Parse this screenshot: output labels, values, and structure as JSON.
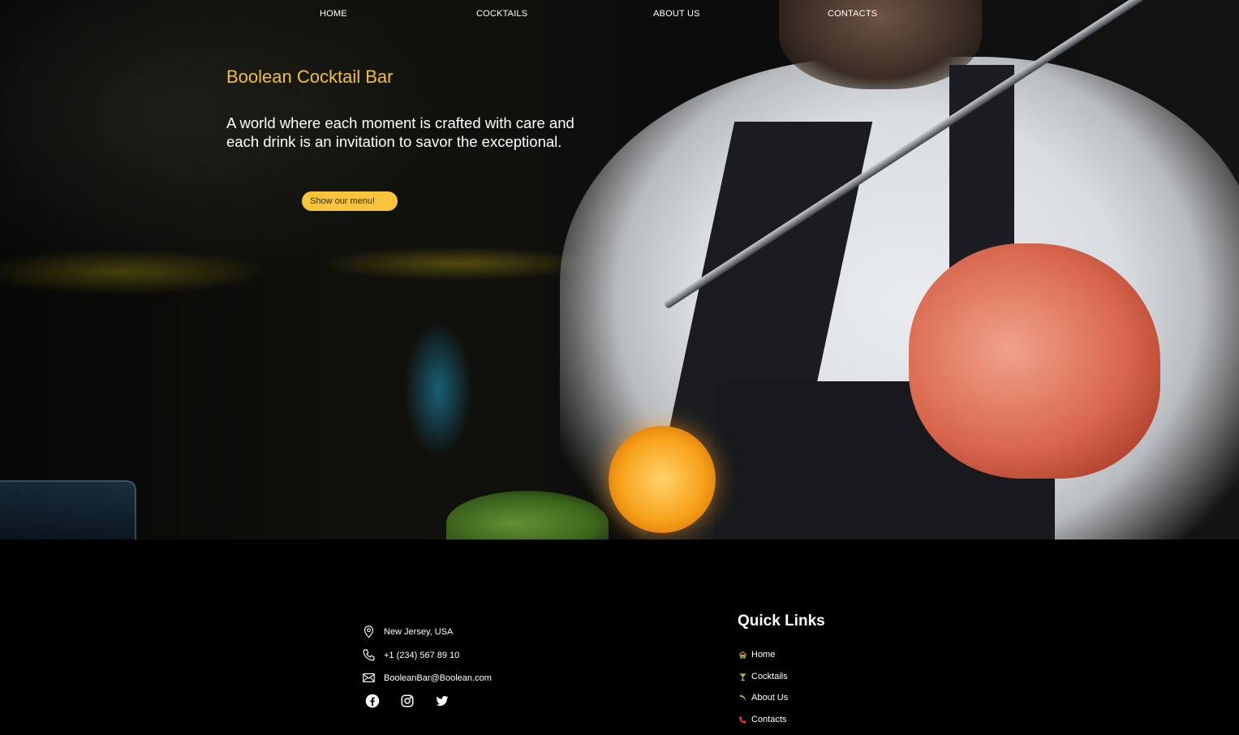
{
  "nav": {
    "items": [
      {
        "label": "HOME"
      },
      {
        "label": "COCKTAILS"
      },
      {
        "label": "ABOUT US"
      },
      {
        "label": "CONTACTS"
      }
    ]
  },
  "hero": {
    "title": "Boolean Cocktail Bar",
    "subtitle": "A world where each moment is crafted with care and each drink is an invitation to savor the exceptional.",
    "cta_label": "Show our menu!"
  },
  "footer": {
    "contacts": [
      {
        "icon": "location-pin-icon",
        "text": "New Jersey, USA"
      },
      {
        "icon": "phone-icon",
        "text": "+1 (234) 567 89 10"
      },
      {
        "icon": "envelope-icon",
        "text": "BooleanBar@Boolean.com"
      }
    ],
    "social": [
      "facebook-icon",
      "instagram-icon",
      "twitter-icon"
    ],
    "quick_links": {
      "title": "Quick Links",
      "items": [
        {
          "icon": "house-icon",
          "label": "Home"
        },
        {
          "icon": "cocktail-glass-icon",
          "label": "Cocktails"
        },
        {
          "icon": "banana-icon",
          "label": "About Us"
        },
        {
          "icon": "telephone-receiver-icon",
          "label": "Contacts"
        }
      ]
    }
  },
  "colors": {
    "accent": "#f2c12e",
    "button": "#f8c43a",
    "footer_bg": "#000000"
  }
}
